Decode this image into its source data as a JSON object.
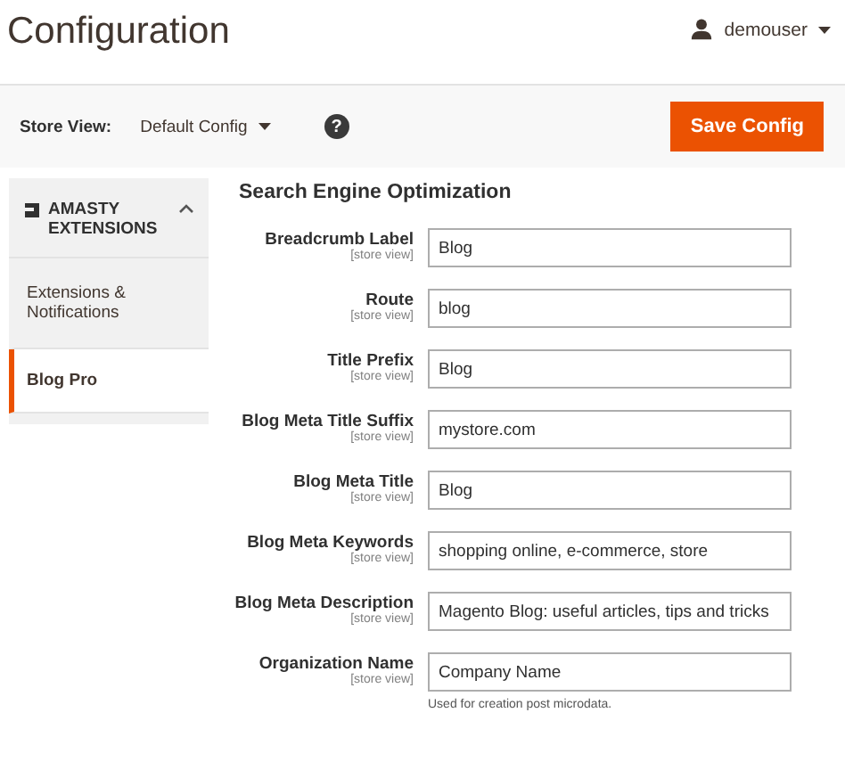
{
  "page_title": "Configuration",
  "user_menu": {
    "name": "demouser"
  },
  "store_view": {
    "label": "Store View:",
    "value": "Default Config",
    "help": "?"
  },
  "save_button": "Save Config",
  "sidebar": {
    "section": {
      "title": "AMASTY EXTENSIONS",
      "expanded": true
    },
    "items": [
      {
        "label": "Extensions & Notifications",
        "selected": false
      },
      {
        "label": "Blog Pro",
        "selected": true
      }
    ]
  },
  "form": {
    "title": "Search Engine Optimization",
    "fields": [
      {
        "label": "Breadcrumb Label",
        "scope": "[store view]",
        "value": "Blog"
      },
      {
        "label": "Route",
        "scope": "[store view]",
        "value": "blog"
      },
      {
        "label": "Title Prefix",
        "scope": "[store view]",
        "value": "Blog"
      },
      {
        "label": "Blog Meta Title Suffix",
        "scope": "[store view]",
        "value": "mystore.com"
      },
      {
        "label": "Blog Meta Title",
        "scope": "[store view]",
        "value": "Blog"
      },
      {
        "label": "Blog Meta Keywords",
        "scope": "[store view]",
        "value": "shopping online, e-commerce, store"
      },
      {
        "label": "Blog Meta Description",
        "scope": "[store view]",
        "value": "Magento Blog: useful articles, tips and tricks"
      },
      {
        "label": "Organization Name",
        "scope": "[store view]",
        "value": "Company Name",
        "note": "Used for creation post microdata."
      }
    ]
  }
}
